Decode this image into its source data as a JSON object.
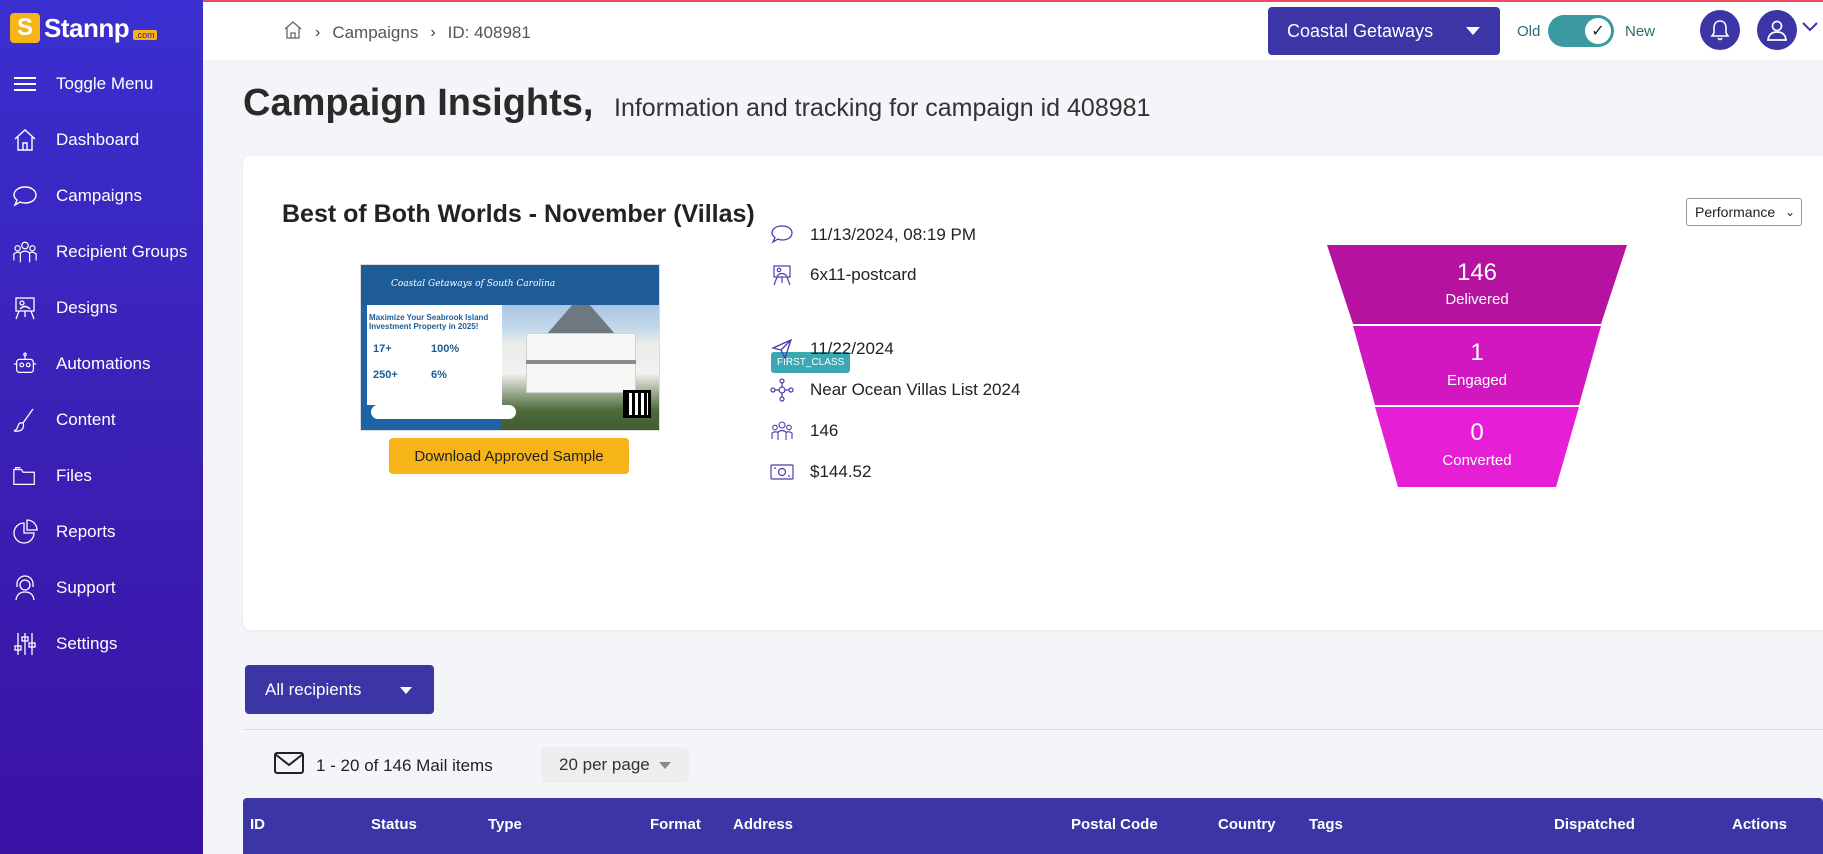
{
  "brand": {
    "name": "Stannp",
    "suffix": ".com",
    "badge": "S"
  },
  "sidebar": {
    "items": [
      {
        "label": "Toggle Menu",
        "icon": "menu-icon"
      },
      {
        "label": "Dashboard",
        "icon": "home-icon"
      },
      {
        "label": "Campaigns",
        "icon": "chat-bubble-icon"
      },
      {
        "label": "Recipient Groups",
        "icon": "group-icon"
      },
      {
        "label": "Designs",
        "icon": "easel-icon"
      },
      {
        "label": "Automations",
        "icon": "robot-icon"
      },
      {
        "label": "Content",
        "icon": "brush-icon"
      },
      {
        "label": "Files",
        "icon": "folder-icon"
      },
      {
        "label": "Reports",
        "icon": "pie-chart-icon"
      },
      {
        "label": "Support",
        "icon": "headset-icon"
      },
      {
        "label": "Settings",
        "icon": "sliders-icon"
      }
    ]
  },
  "header": {
    "breadcrumb": [
      "Campaigns",
      "ID: 408981"
    ],
    "org_select": "Coastal Getaways",
    "toggle": {
      "old": "Old",
      "new": "New",
      "state": "New"
    }
  },
  "page": {
    "title": "Campaign Insights,",
    "subtitle": "Information and tracking for campaign id 408981"
  },
  "campaign": {
    "name": "Best of Both Worlds - November (Villas)",
    "view_select": "Performance",
    "download_label": "Download Approved Sample",
    "postcard": {
      "brand": "Coastal Getaways of South Carolina",
      "heading": "Maximize Your Seabrook Island Investment Property in 2025!",
      "stats": [
        "17+",
        "100%",
        "250+",
        "6%"
      ]
    },
    "details": {
      "created": "11/13/2024, 08:19 PM",
      "size": "6x11-postcard",
      "class_badge": "FIRST_CLASS",
      "dispatch_date": "11/22/2024",
      "group": "Near Ocean Villas List 2024",
      "recipients": "146",
      "cost": "$144.52"
    },
    "funnel": [
      {
        "value": "146",
        "label": "Delivered",
        "color": "#b5139f"
      },
      {
        "value": "1",
        "label": "Engaged",
        "color": "#d317c0"
      },
      {
        "value": "0",
        "label": "Converted",
        "color": "#e61fd6"
      }
    ]
  },
  "recipients": {
    "filter": "All recipients",
    "count_text": "1 - 20 of 146 Mail items",
    "per_page": "20 per page",
    "columns": [
      "ID",
      "Status",
      "Type",
      "Format",
      "Address",
      "Postal Code",
      "Country",
      "Tags",
      "Dispatched",
      "Actions"
    ]
  },
  "colors": {
    "primary": "#3b35a6",
    "accent": "#f7b419",
    "badge": "#3aa9b3"
  }
}
